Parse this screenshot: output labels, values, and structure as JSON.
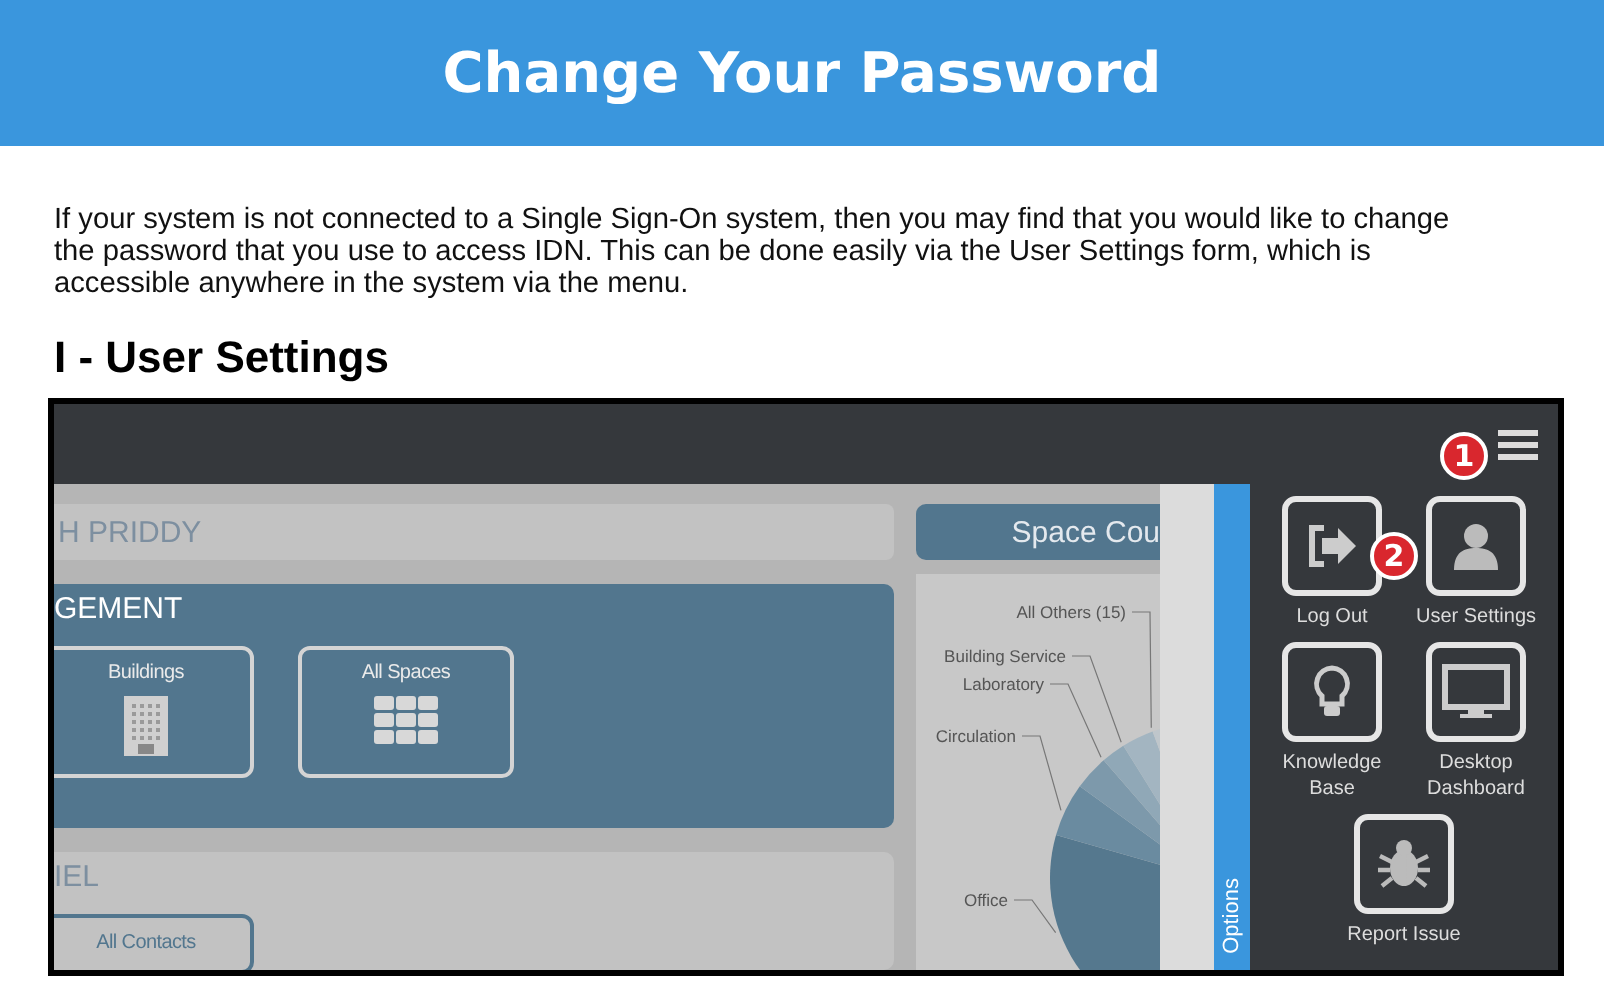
{
  "header": {
    "title": "Change Your Password"
  },
  "intro": "If your system is not connected to a Single Sign-On system, then you may find that you would like to change the password that you use to access IDN.  This can be done easily via the User Settings form, which is accessible anywhere in the system via the menu.",
  "section_heading": "I - User Settings",
  "screenshot": {
    "name_bar": "H PRIDDY",
    "management": {
      "title": "GEMENT",
      "tiles": [
        {
          "label": "Buildings",
          "kind": "building"
        },
        {
          "label": "All Spaces",
          "kind": "grid"
        }
      ]
    },
    "personnel": {
      "title": "IEL",
      "tiles": [
        {
          "label": "All Contacts"
        }
      ]
    },
    "chart": {
      "title": "Space Cou",
      "labels": [
        "All Others (15)",
        "Building Service",
        "Laboratory",
        "Circulation",
        "Office"
      ]
    },
    "options_tab": "Options",
    "menu": [
      {
        "label": "Log Out",
        "kind": "logout"
      },
      {
        "label": "User Settings",
        "kind": "user"
      },
      {
        "label": "Knowledge\nBase",
        "kind": "bulb"
      },
      {
        "label": "Desktop\nDashboard",
        "kind": "monitor"
      },
      {
        "label": "Report Issue",
        "kind": "bug"
      }
    ],
    "callouts": [
      "1",
      "2"
    ]
  }
}
